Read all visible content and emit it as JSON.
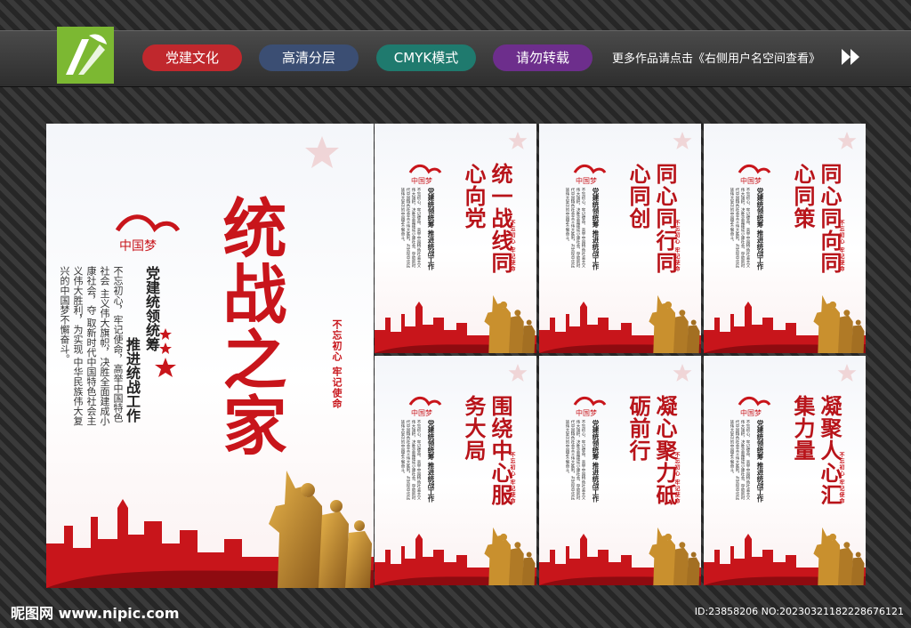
{
  "header": {
    "tags": [
      {
        "label": "党建文化",
        "color": "#c0282d"
      },
      {
        "label": "高清分层",
        "color": "#3b4e73"
      },
      {
        "label": "CMYK模式",
        "color": "#1f7a6e"
      },
      {
        "label": "请勿转载",
        "color": "#6d2e8c"
      }
    ],
    "note": "更多作品请点击《右侧用户名空间查看》"
  },
  "main_poster": {
    "title": "统战之家",
    "subtitle_right": "党建统领统筹",
    "subtitle_left": "推进统战工作",
    "body_lines": [
      "不忘初心，牢记使命，高举中国特色社会",
      "主义伟大旗帜，决胜全面建成小康社会，夺",
      "取新时代中国特色社会主义伟大胜利，为实现",
      "中华民族伟大复兴的中国梦不懈奋斗。"
    ],
    "seal_text": "不忘初心 牢记使命",
    "logo_text": "中国梦"
  },
  "small_posters": [
    {
      "title": "统一战线同心向党"
    },
    {
      "title": "同心同行同心同创"
    },
    {
      "title": "同心同向同心同策"
    },
    {
      "title": "围绕中心服务大局"
    },
    {
      "title": "凝心聚力砥砺前行"
    },
    {
      "title": "凝聚人心汇集力量"
    }
  ],
  "small_common": {
    "subtitle": "党建统领统筹 推进统战工作",
    "seal": "不忘初心 牢记使命",
    "body": "不忘初心，牢记使命，高举中国特色社会主义伟大旗帜，决胜全面建成小康社会，夺取新时代中国特色社会主义伟大胜利，为实现中华民族伟大复兴的中国梦不懈奋斗。",
    "logo_text": "中国梦"
  },
  "footer": {
    "site": "昵图网 www.nipic.com",
    "id": "ID:23858206 NO:20230321182228676121"
  },
  "colors": {
    "red": "#c8151b",
    "gold": "#c9902e"
  }
}
